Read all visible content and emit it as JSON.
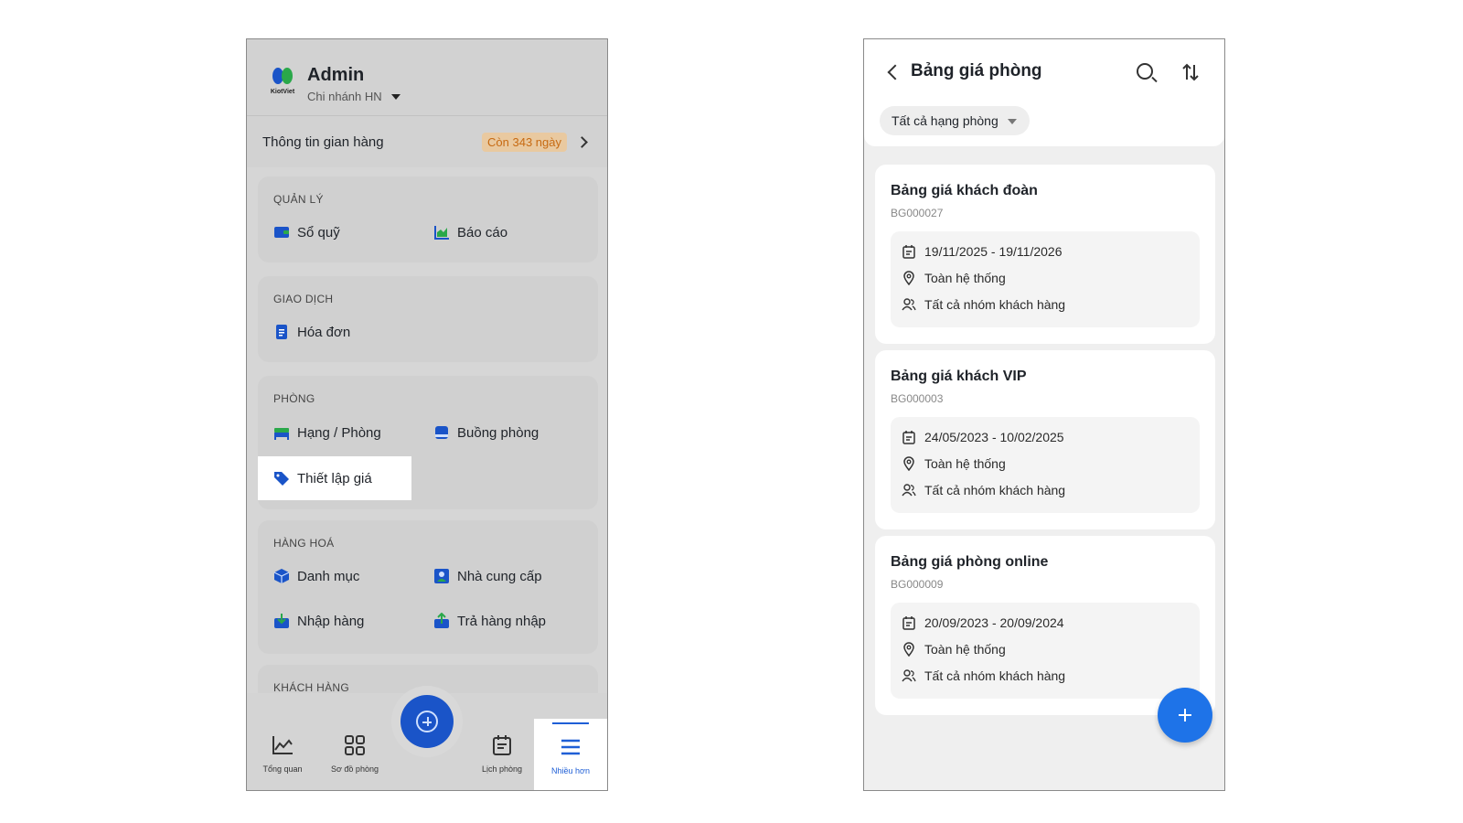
{
  "left": {
    "header": {
      "user_name": "Admin",
      "branch": "Chi nhánh HN",
      "logo_text": "KiotViet"
    },
    "store": {
      "label": "Thông tin gian hàng",
      "badge": "Còn 343 ngày"
    },
    "sections": {
      "quan_ly": {
        "title": "QUẢN LÝ",
        "items": [
          "Sổ quỹ",
          "Báo cáo"
        ]
      },
      "giao_dich": {
        "title": "GIAO DỊCH",
        "items": [
          "Hóa đơn"
        ]
      },
      "phong": {
        "title": "PHÒNG",
        "items": [
          "Hạng / Phòng",
          "Buồng phòng",
          "Thiết lập giá"
        ]
      },
      "hang_hoa": {
        "title": "HÀNG HOÁ",
        "items": [
          "Danh mục",
          "Nhà cung cấp",
          "Nhập hàng",
          "Trả hàng nhập"
        ]
      },
      "khach_hang": {
        "title": "KHÁCH HÀNG"
      }
    },
    "bottom_nav": [
      "Tổng quan",
      "Sơ đồ phòng",
      "Lịch phòng",
      "Nhiều hơn"
    ],
    "colors": {
      "fab": "#1a54c8",
      "active": "#1f5fd6",
      "badge": "#c76a12"
    }
  },
  "right": {
    "header": {
      "title": "Bảng giá phòng"
    },
    "filter": {
      "label": "Tất cả hạng phòng"
    },
    "cards": [
      {
        "title": "Bảng giá khách đoàn",
        "code": "BG000027",
        "dates": "19/11/2025 - 19/11/2026",
        "scope": "Toàn hệ thống",
        "customers": "Tất cả nhóm khách hàng"
      },
      {
        "title": "Bảng giá khách VIP",
        "code": "BG000003",
        "dates": "24/05/2023 - 10/02/2025",
        "scope": "Toàn hệ thống",
        "customers": "Tất cả nhóm khách hàng"
      },
      {
        "title": "Bảng giá phòng online",
        "code": "BG000009",
        "dates": "20/09/2023 - 20/09/2024",
        "scope": "Toàn hệ thống",
        "customers": "Tất cả nhóm khách hàng"
      }
    ],
    "colors": {
      "fab": "#1e73e8"
    }
  }
}
